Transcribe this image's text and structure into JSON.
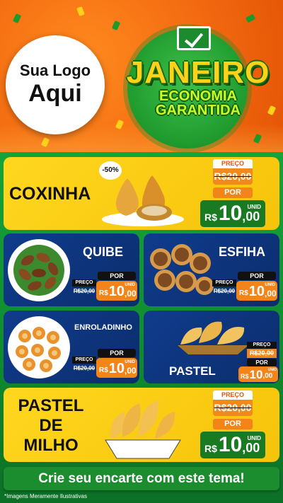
{
  "header": {
    "logo_line1": "Sua Logo",
    "logo_line2": "Aqui",
    "month": "JANEIRO",
    "tagline_1": "ECONOMIA",
    "tagline_2": "GARANTIDA",
    "check_icon": "check-box-icon"
  },
  "colors": {
    "header_orange": "#f36a10",
    "green": "#1c8d2e",
    "yellow": "#ffd71f",
    "blue": "#0b2d6d",
    "price_orange": "#f2841a"
  },
  "products": [
    {
      "name": "COXINHA",
      "discount": "-50%",
      "preco_label": "PREÇO",
      "old_price": "R$20,00",
      "por_label": "POR",
      "currency": "R$",
      "price_int": "10",
      "price_dec": ",00",
      "unit": "UNID"
    },
    {
      "name": "QUIBE",
      "preco_label": "PREÇO",
      "old_price": "R$20,00",
      "por_label": "POR",
      "currency": "R$",
      "price_int": "10",
      "price_dec": ",00",
      "unit": "UNID"
    },
    {
      "name": "ESFIHA",
      "preco_label": "PREÇO",
      "old_price": "R$20,00",
      "por_label": "POR",
      "currency": "R$",
      "price_int": "10",
      "price_dec": ",00",
      "unit": "UNID"
    },
    {
      "name": "ENROLADINHO",
      "preco_label": "PREÇO",
      "old_price": "R$20,00",
      "por_label": "POR",
      "currency": "R$",
      "price_int": "10",
      "price_dec": ",00",
      "unit": "UNID"
    },
    {
      "name": "PASTEL",
      "preco_label": "PREÇO",
      "old_price": "R$20,00",
      "por_label": "POR",
      "currency": "R$",
      "price_int": "10",
      "price_dec": ",00",
      "unit": "UNID"
    },
    {
      "name_line1": "PASTEL",
      "name_line2": "DE",
      "name_line3": "MILHO",
      "preco_label": "PREÇO",
      "old_price": "R$20,00",
      "por_label": "POR",
      "currency": "R$",
      "price_int": "10",
      "price_dec": ",00",
      "unit": "UNID"
    }
  ],
  "footer": {
    "cta": "Crie seu encarte com este tema!",
    "note": "*Imagens Meramente Ilustrativas"
  }
}
